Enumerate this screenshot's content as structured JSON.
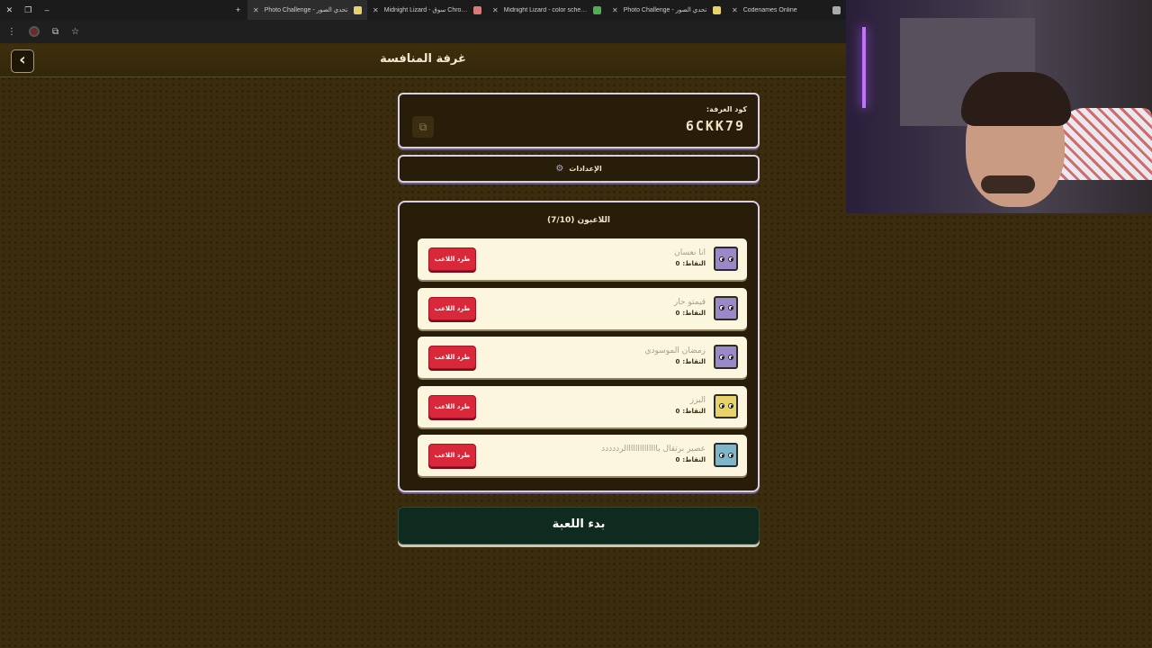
{
  "browser": {
    "tabs": [
      {
        "title": "Photo Challenge - تحدي الصور",
        "favicon_color": "#e8d36a",
        "active": true
      },
      {
        "title": "Midnight Lizard - سوق Chrome",
        "favicon_color": "#d97a7a",
        "active": false
      },
      {
        "title": "Midnight Lizard - color schemes",
        "favicon_color": "#4caf50",
        "active": false
      },
      {
        "title": "Photo Challenge - تحدي الصور",
        "favicon_color": "#e8d36a",
        "active": false
      },
      {
        "title": "Codenames Online",
        "favicon_color": "#aaaaaa",
        "active": false
      }
    ]
  },
  "header": {
    "title": "غرفة المنافسة",
    "back_icon": "chevron-left-icon"
  },
  "room": {
    "code_label": "كود الغرفة:",
    "code": "6CKK79",
    "copy_icon": "copy-icon"
  },
  "settings": {
    "label": "الإعدادات",
    "icon": "gear-icon"
  },
  "players": {
    "heading": "اللاعبون (7/10)",
    "points_label": "النقاط:",
    "kick_label": "طرد اللاعب",
    "list": [
      {
        "name": "انا نعسان",
        "points": "0",
        "avatar_color": "#9b88c9"
      },
      {
        "name": "قيمتو حار",
        "points": "0",
        "avatar_color": "#9b88c9"
      },
      {
        "name": "رمضان الموسودي",
        "points": "0",
        "avatar_color": "#9b88c9"
      },
      {
        "name": "البزز",
        "points": "0",
        "avatar_color": "#e8d36a"
      },
      {
        "name": "عصير برتقال باااااااااااااالرددددد",
        "points": "0",
        "avatar_color": "#7fb6c9"
      }
    ]
  },
  "start": {
    "label": "بدء اللعبة"
  }
}
